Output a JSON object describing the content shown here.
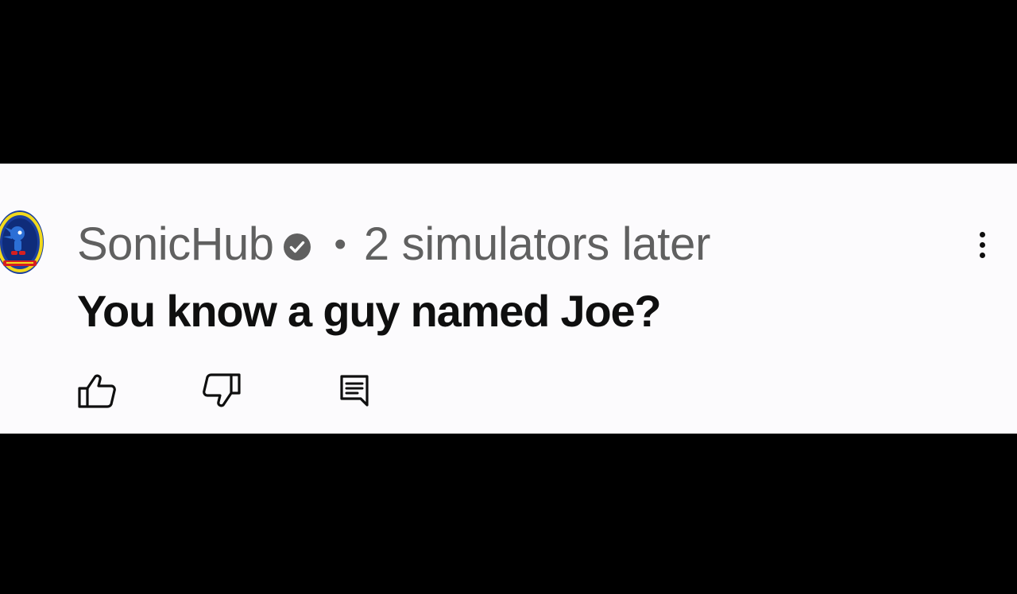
{
  "comment": {
    "author": "SonicHub",
    "verified": true,
    "separator": "•",
    "timestamp": "2 simulators later",
    "text": "You know a guy named Joe?"
  },
  "icons": {
    "avatar": "sonic-avatar-icon",
    "verified": "verified-check-icon",
    "more": "more-vertical-icon",
    "like": "thumbs-up-icon",
    "dislike": "thumbs-down-icon",
    "reply": "reply-comment-icon"
  },
  "colors": {
    "background": "#000000",
    "card": "#fcfbfd",
    "meta_text": "#606060",
    "comment_text": "#0f0f0f"
  }
}
